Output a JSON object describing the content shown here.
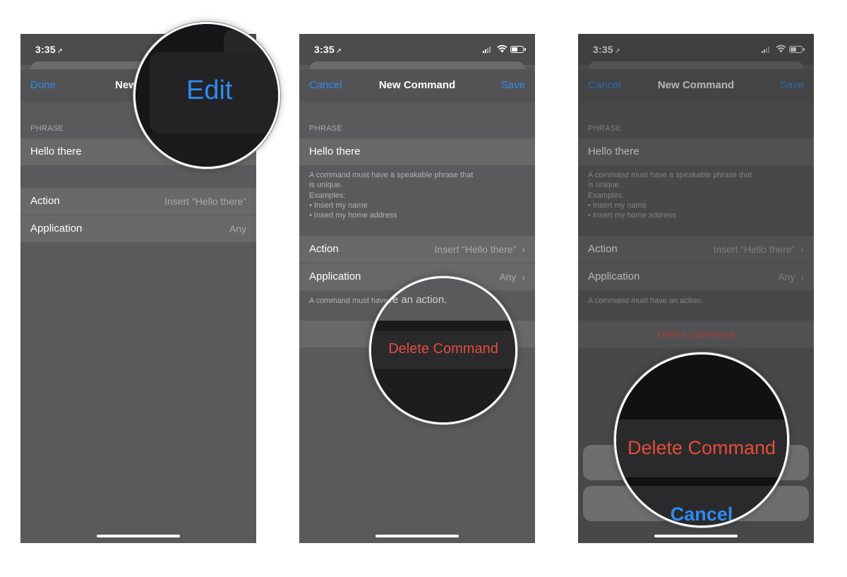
{
  "status": {
    "time": "3:35"
  },
  "panel1": {
    "nav": {
      "left": "Done",
      "title": "New C"
    },
    "phrase_header": "PHRASE",
    "phrase_value": "Hello there",
    "rows": [
      {
        "label": "Action",
        "value": "Insert “Hello there”"
      },
      {
        "label": "Application",
        "value": "Any"
      }
    ],
    "magnifier": {
      "label": "Edit"
    }
  },
  "panel2": {
    "nav": {
      "left": "Cancel",
      "title": "New Command",
      "right": "Save"
    },
    "phrase_header": "PHRASE",
    "phrase_value": "Hello there",
    "phrase_footer": "A command must have a speakable phrase that\nis unique.\nExamples:\n• Insert my name\n• Insert my home address",
    "rows": [
      {
        "label": "Action",
        "value": "Insert “Hello there”"
      },
      {
        "label": "Application",
        "value": "Any"
      }
    ],
    "action_footer": "A command must have an action.",
    "magnifier": {
      "top_text": "ave an action.",
      "label": "Delete Command"
    }
  },
  "panel3": {
    "nav": {
      "left": "Cancel",
      "title": "New Command",
      "right": "Save"
    },
    "phrase_header": "PHRASE",
    "phrase_value": "Hello there",
    "phrase_footer": "A command must have a speakable phrase that\nis unique.\nExamples:\n• Insert my name\n• Insert my home address",
    "rows": [
      {
        "label": "Action",
        "value": "Insert “Hello there”"
      },
      {
        "label": "Application",
        "value": "Any"
      }
    ],
    "action_footer": "A command must have an action.",
    "delete_label": "Delete Command",
    "magnifier": {
      "delete_label": "Delete Command",
      "cancel_label": "Cancel"
    }
  },
  "colors": {
    "accent_blue": "#2f8af0",
    "destructive_red": "#e74c3c"
  },
  "icons": [
    "location-arrow-icon",
    "signal-icon",
    "wifi-icon",
    "battery-icon",
    "chevron-right-icon"
  ]
}
